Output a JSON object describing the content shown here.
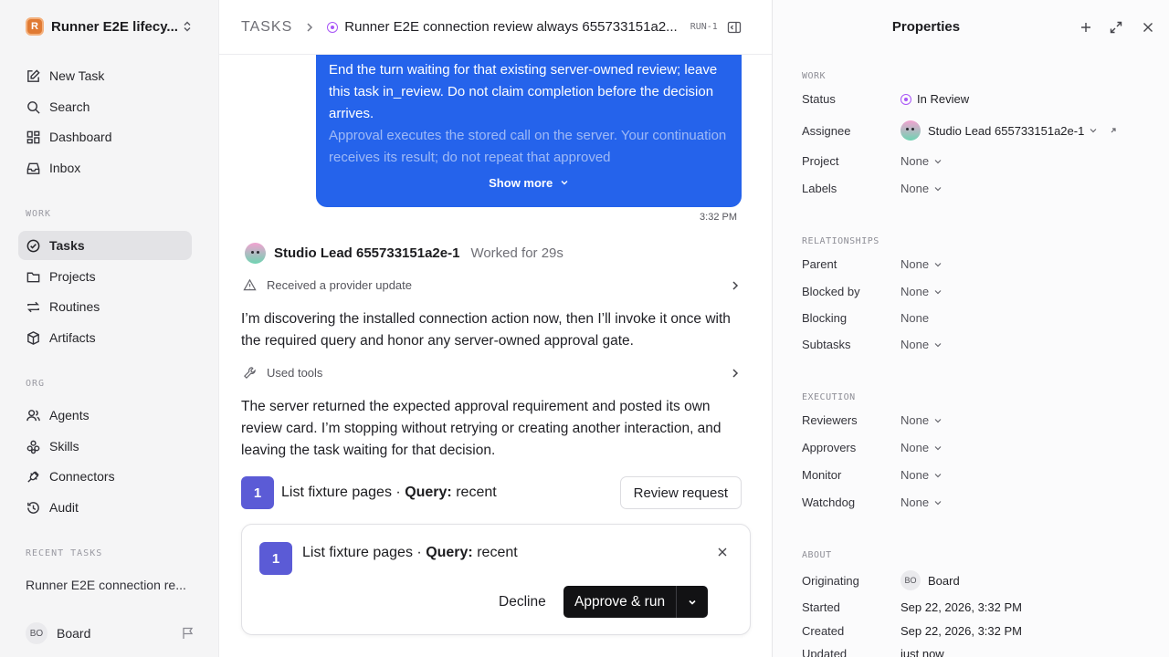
{
  "workspace": {
    "initial": "R",
    "name": "Runner E2E lifecy..."
  },
  "nav": [
    {
      "label": "New Task",
      "icon": "edit-icon"
    },
    {
      "label": "Search",
      "icon": "search-icon"
    },
    {
      "label": "Dashboard",
      "icon": "dashboard-icon"
    },
    {
      "label": "Inbox",
      "icon": "inbox-icon"
    }
  ],
  "work_section": "WORK",
  "work_nav": [
    {
      "label": "Tasks",
      "icon": "check-circle-icon",
      "active": true
    },
    {
      "label": "Projects",
      "icon": "folder-icon"
    },
    {
      "label": "Routines",
      "icon": "repeat-icon"
    },
    {
      "label": "Artifacts",
      "icon": "box-icon"
    }
  ],
  "org_section": "ORG",
  "org_nav": [
    {
      "label": "Agents",
      "icon": "users-icon"
    },
    {
      "label": "Skills",
      "icon": "skills-icon"
    },
    {
      "label": "Connectors",
      "icon": "plug-icon"
    },
    {
      "label": "Audit",
      "icon": "history-icon"
    }
  ],
  "recent_section": "RECENT TASKS",
  "recent_task": "Runner E2E connection re...",
  "user": {
    "initials": "BO",
    "name": "Board"
  },
  "header": {
    "crumb": "TASKS",
    "title": "Runner E2E connection review always 655733151a2...",
    "run_id": "RUN-1"
  },
  "message": {
    "para1": "End the turn waiting for that existing server-owned review; leave this task in_review. Do not claim completion before the decision arrives.",
    "para2": "Approval executes the stored call on the server. Your continuation receives its result; do not repeat that approved",
    "show_more": "Show more",
    "time": "3:32 PM"
  },
  "agent": {
    "name": "Studio Lead 655733151a2e-1",
    "worked": "Worked for 29s"
  },
  "events": {
    "provider_update": "Received a provider update",
    "text1": "I’m discovering the installed connection action now, then I’ll invoke it once with the required query and honor any server-owned approval gate.",
    "used_tools": "Used tools",
    "text2": "The server returned the expected approval requirement and posted its own review card. I’m stopping without retrying or creating another interaction, and leaving the task waiting for that decision."
  },
  "request": {
    "number": "1",
    "action": "List fixture pages ·",
    "query_label": "Query:",
    "query_value": "recent",
    "review_button": "Review request"
  },
  "approval_card": {
    "number": "1",
    "action": "List fixture pages ·",
    "query_label": "Query:",
    "query_value": "recent",
    "decline": "Decline",
    "approve": "Approve & run"
  },
  "properties": {
    "title": "Properties",
    "work_section": "WORK",
    "status_label": "Status",
    "status_value": "In Review",
    "status_color": "#a855f7",
    "assignee_label": "Assignee",
    "assignee_value": "Studio Lead 655733151a2e-1",
    "project_label": "Project",
    "project_value": "None",
    "labels_label": "Labels",
    "labels_value": "None",
    "relationships_section": "RELATIONSHIPS",
    "parent_label": "Parent",
    "parent_value": "None",
    "blocked_by_label": "Blocked by",
    "blocked_by_value": "None",
    "blocking_label": "Blocking",
    "blocking_value": "None",
    "subtasks_label": "Subtasks",
    "subtasks_value": "None",
    "execution_section": "EXECUTION",
    "reviewers_label": "Reviewers",
    "reviewers_value": "None",
    "approvers_label": "Approvers",
    "approvers_value": "None",
    "monitor_label": "Monitor",
    "monitor_value": "None",
    "watchdog_label": "Watchdog",
    "watchdog_value": "None",
    "about_section": "ABOUT",
    "originating_label": "Originating",
    "originating_initials": "BO",
    "originating_value": "Board",
    "started_label": "Started",
    "started_value": "Sep 22, 2026, 3:32 PM",
    "created_label": "Created",
    "created_value": "Sep 22, 2026, 3:32 PM",
    "updated_label": "Updated",
    "updated_value": "just now"
  },
  "colors": {
    "accent_blue": "#2563eb",
    "badge_indigo": "#5b5bd6",
    "review_purple": "#a855f7"
  }
}
